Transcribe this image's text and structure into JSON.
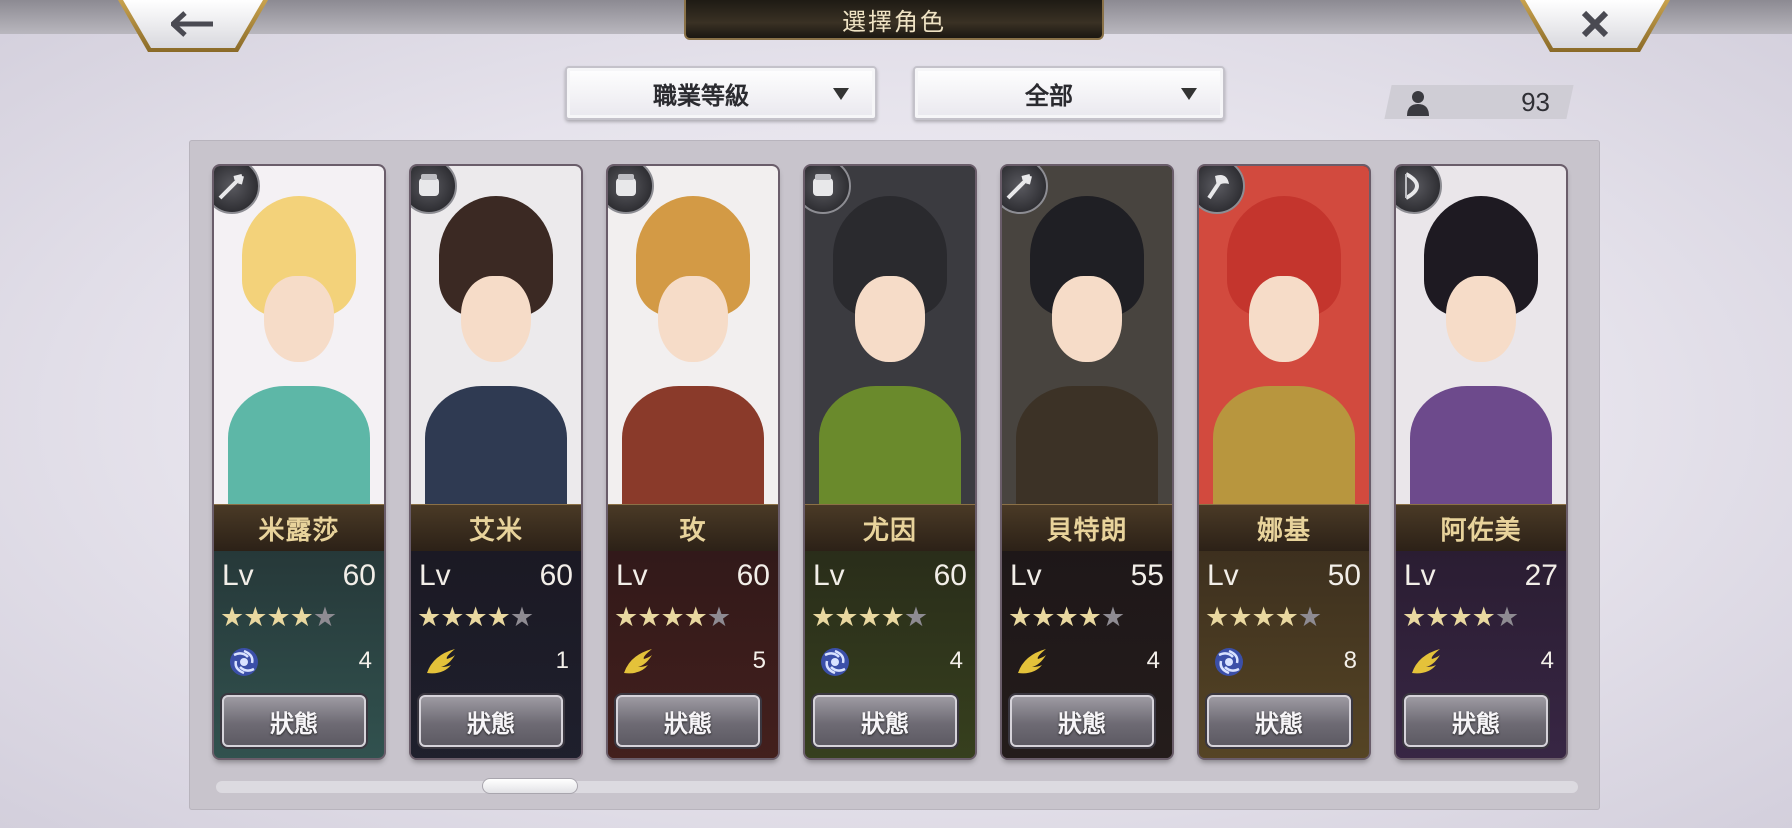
{
  "header": {
    "title": "選擇角色",
    "back_icon": "back-arrow-icon",
    "close_icon": "close-icon"
  },
  "filters": {
    "job_level": "職業等級",
    "category": "全部"
  },
  "roster": {
    "count": "93",
    "icon": "person-icon"
  },
  "characters": [
    {
      "name": "米露莎",
      "lv_label": "Lv",
      "level": "60",
      "stars": 4,
      "max_stars": 5,
      "class_icon": "spear-icon",
      "element_icon": "swirl-icon",
      "element_count": "4",
      "status_label": "狀態",
      "colors": {
        "hair": "#f3d27a",
        "body": "#5db7a7",
        "bg": "#f4f1f4"
      }
    },
    {
      "name": "艾米",
      "lv_label": "Lv",
      "level": "60",
      "stars": 4,
      "max_stars": 5,
      "class_icon": "gauntlet-icon",
      "element_icon": "wing-icon",
      "element_count": "1",
      "status_label": "狀態",
      "colors": {
        "hair": "#3b2923",
        "body": "#2f3a52",
        "bg": "#eceaec"
      }
    },
    {
      "name": "玫",
      "lv_label": "Lv",
      "level": "60",
      "stars": 4,
      "max_stars": 5,
      "class_icon": "gauntlet-icon",
      "element_icon": "wing-icon",
      "element_count": "5",
      "status_label": "狀態",
      "colors": {
        "hair": "#d39a45",
        "body": "#8a3a2a",
        "bg": "#f2efef"
      }
    },
    {
      "name": "尤因",
      "lv_label": "Lv",
      "level": "60",
      "stars": 4,
      "max_stars": 5,
      "class_icon": "gauntlet-icon",
      "element_icon": "swirl-icon",
      "element_count": "4",
      "status_label": "狀態",
      "colors": {
        "hair": "#2a2a2e",
        "body": "#6a8a2c",
        "bg": "#3b3b40"
      }
    },
    {
      "name": "貝特朗",
      "lv_label": "Lv",
      "level": "55",
      "stars": 4,
      "max_stars": 5,
      "class_icon": "spear-icon",
      "element_icon": "wing-icon",
      "element_count": "4",
      "status_label": "狀態",
      "colors": {
        "hair": "#1f1f24",
        "body": "#3c3226",
        "bg": "#48443f"
      }
    },
    {
      "name": "娜基",
      "lv_label": "Lv",
      "level": "50",
      "stars": 4,
      "max_stars": 5,
      "class_icon": "axe-icon",
      "element_icon": "swirl-icon",
      "element_count": "8",
      "status_label": "狀態",
      "colors": {
        "hair": "#c4352d",
        "body": "#b8963e",
        "bg": "#d24a3e"
      }
    },
    {
      "name": "阿佐美",
      "lv_label": "Lv",
      "level": "27",
      "stars": 4,
      "max_stars": 5,
      "class_icon": "bow-icon",
      "element_icon": "wing-icon",
      "element_count": "4",
      "status_label": "狀態",
      "colors": {
        "hair": "#1e1a22",
        "body": "#6d4a8c",
        "bg": "#eae6ea"
      }
    }
  ],
  "scroll": {
    "position": 0.2
  }
}
